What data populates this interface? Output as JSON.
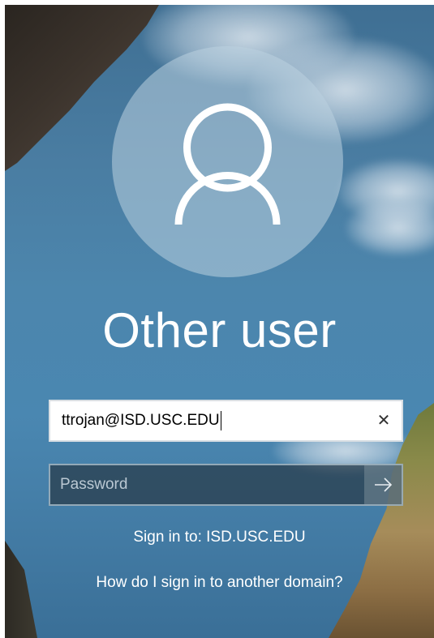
{
  "user": {
    "display_name": "Other user",
    "avatar_icon": "user-silhouette-icon"
  },
  "username_field": {
    "value": "ttrojan@ISD.USC.EDU",
    "clear_icon": "close-icon",
    "clear_glyph": "✕"
  },
  "password_field": {
    "placeholder": "Password",
    "submit_icon": "arrow-right-icon"
  },
  "sign_in_to": "Sign in to: ISD.USC.EDU",
  "other_domain_link": "How do I sign in to another domain?",
  "colors": {
    "text": "#ffffff",
    "field_bg": "#ffffff",
    "password_bg": "#283a48"
  }
}
